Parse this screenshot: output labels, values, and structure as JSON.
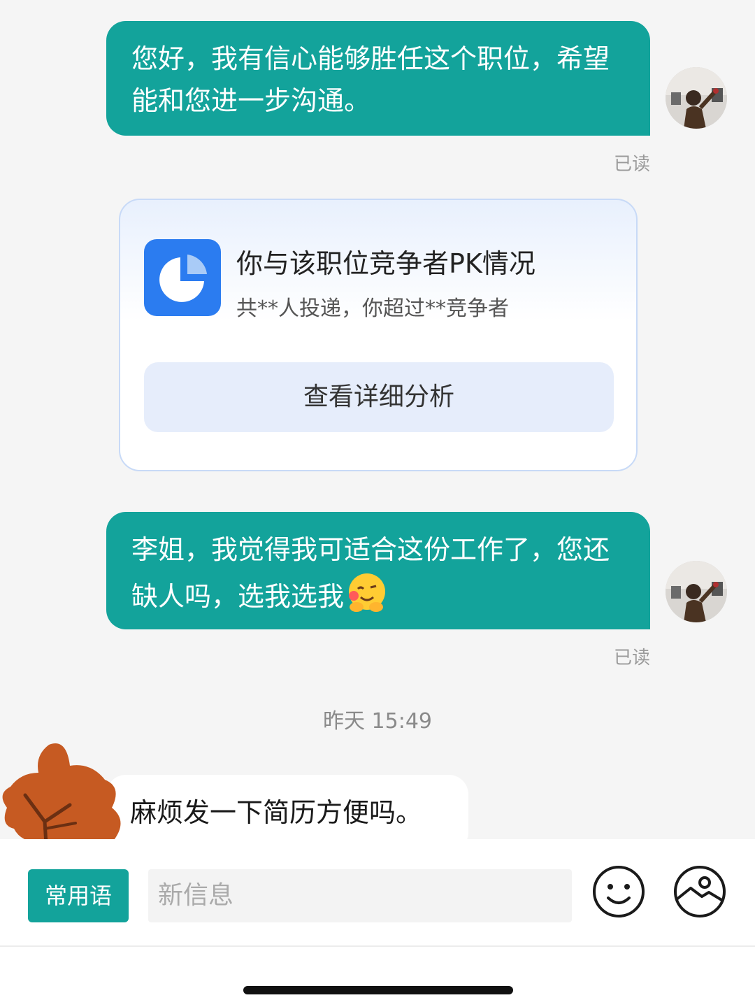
{
  "messages": [
    {
      "text": "您好，我有信心能够胜任这个职位，希望能和您进一步沟通。",
      "status": "已读"
    },
    {
      "text": "李姐，我觉得我可适合这份工作了，您还缺人吗，选我选我",
      "emoji": "hugging-face-emoji",
      "status": "已读"
    }
  ],
  "pk_card": {
    "title": "你与该职位竞争者PK情况",
    "subtitle": "共**人投递，你超过**竞争者",
    "button_label": "查看详细分析",
    "icon": "pie-chart-icon"
  },
  "timestamp": "昨天 15:49",
  "incoming": {
    "text": "麻烦发一下简历方便吗。"
  },
  "input_bar": {
    "quick_phrases_label": "常用语",
    "placeholder": "新信息",
    "emoji_icon": "smiley-icon",
    "image_icon": "image-icon"
  },
  "colors": {
    "accent": "#13a39b",
    "card_icon": "#2b7cf0",
    "leaf": "#c65a22"
  }
}
